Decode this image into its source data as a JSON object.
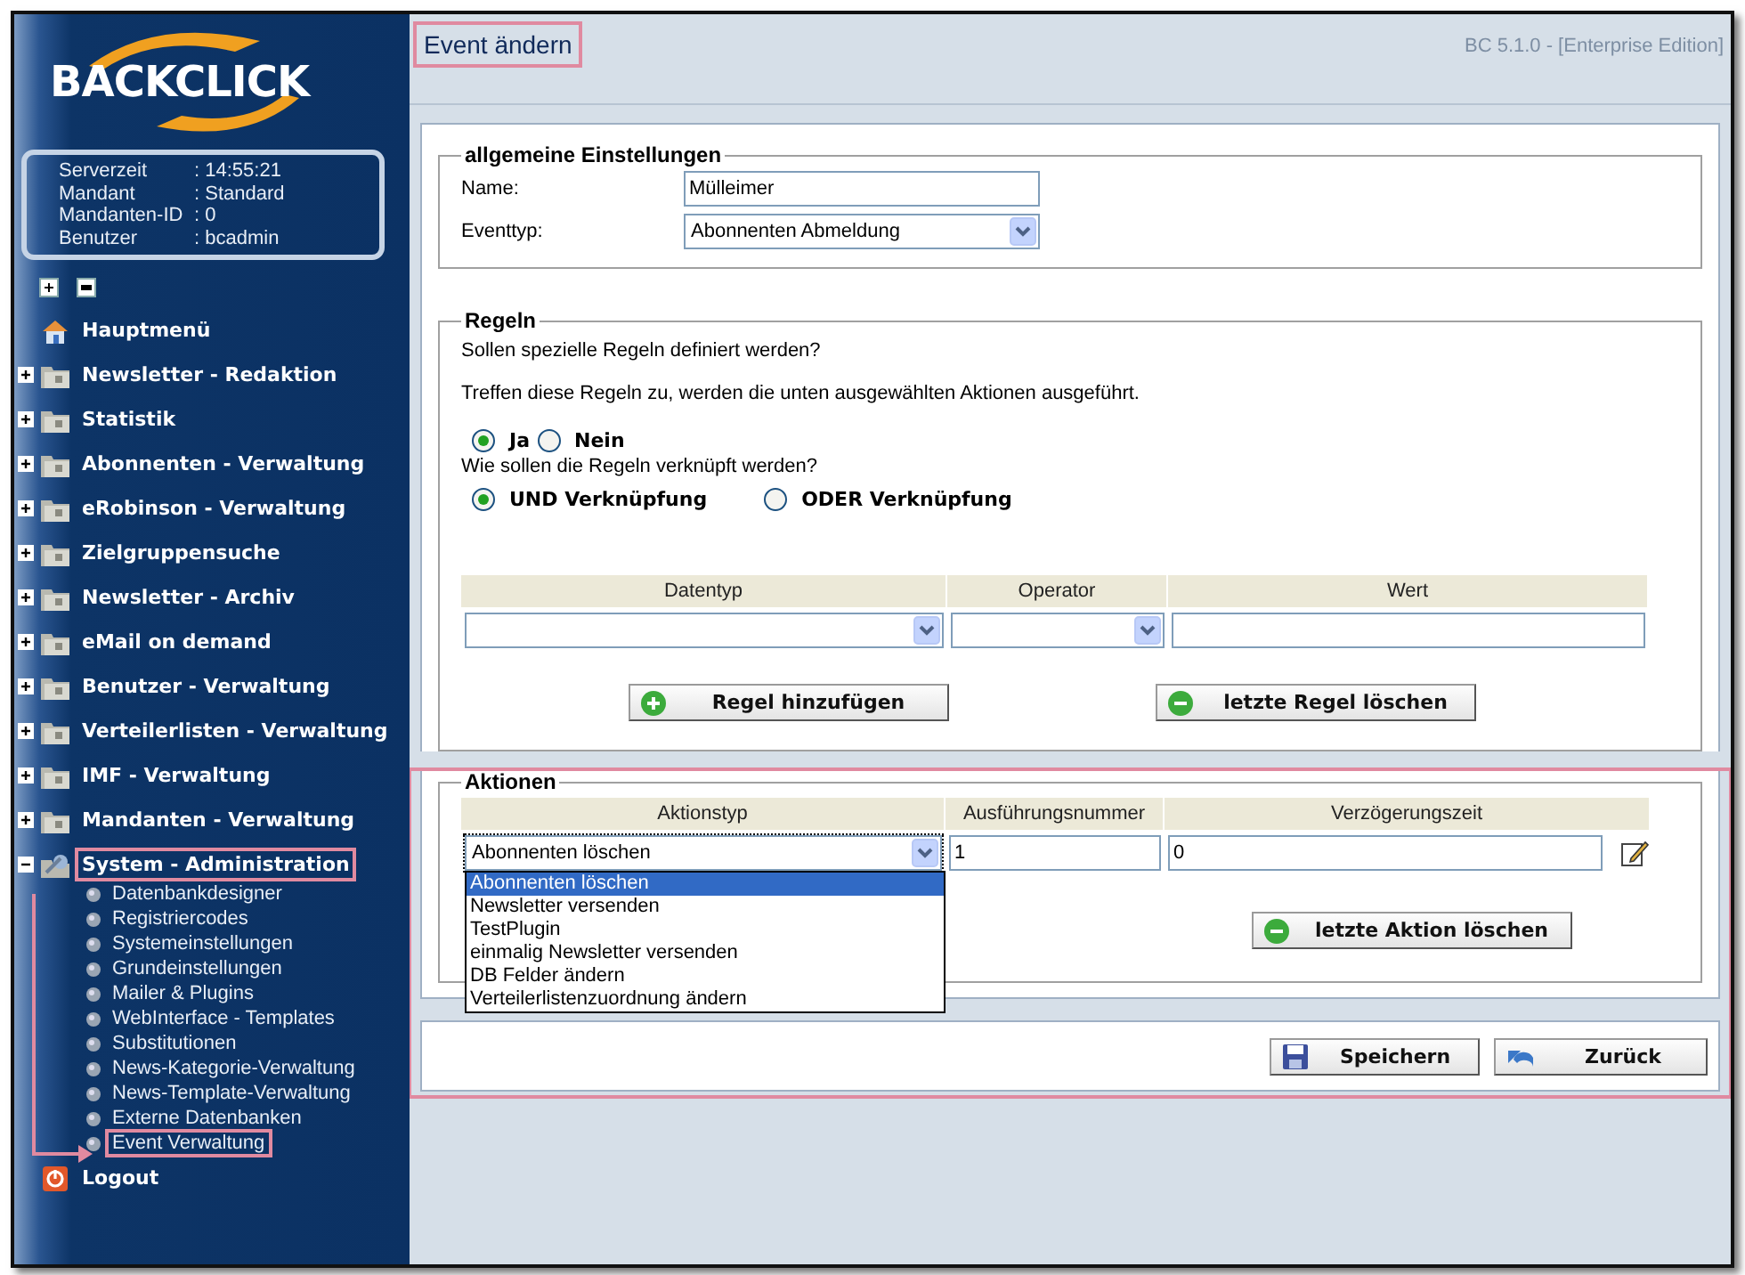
{
  "sidebar": {
    "logo": "BACKCLICK",
    "info": [
      {
        "label": "Serverzeit",
        "value": ": 14:55:21"
      },
      {
        "label": "Mandant",
        "value": ": Standard"
      },
      {
        "label": "Mandanten-ID",
        "value": ": 0"
      },
      {
        "label": "Benutzer",
        "value": ": bcadmin"
      }
    ],
    "nav": [
      {
        "label": "Hauptmenü",
        "kind": "home"
      },
      {
        "label": "Newsletter - Redaktion",
        "kind": "folder",
        "expanded": false,
        "highlighted": false
      },
      {
        "label": "Statistik",
        "kind": "folder",
        "expanded": false,
        "highlighted": false
      },
      {
        "label": "Abonnenten - Verwaltung",
        "kind": "folder",
        "expanded": false,
        "highlighted": false
      },
      {
        "label": "eRobinson - Verwaltung",
        "kind": "folder",
        "expanded": false,
        "highlighted": false
      },
      {
        "label": "Zielgruppensuche",
        "kind": "folder",
        "expanded": false,
        "highlighted": false
      },
      {
        "label": "Newsletter - Archiv",
        "kind": "folder",
        "expanded": false,
        "highlighted": false
      },
      {
        "label": "eMail on demand",
        "kind": "folder",
        "expanded": false,
        "highlighted": false
      },
      {
        "label": "Benutzer - Verwaltung",
        "kind": "folder",
        "expanded": false,
        "highlighted": false
      },
      {
        "label": "Verteilerlisten - Verwaltung",
        "kind": "folder",
        "expanded": false,
        "highlighted": false
      },
      {
        "label": "IMF - Verwaltung",
        "kind": "folder",
        "expanded": false,
        "highlighted": false
      },
      {
        "label": "Mandanten - Verwaltung",
        "kind": "folder",
        "expanded": false,
        "highlighted": false
      },
      {
        "label": "System - Administration",
        "kind": "system",
        "expanded": true,
        "highlighted": true,
        "children": [
          {
            "label": "Datenbankdesigner",
            "highlighted": false
          },
          {
            "label": "Registriercodes",
            "highlighted": false
          },
          {
            "label": "Systemeinstellungen",
            "highlighted": false
          },
          {
            "label": "Grundeinstellungen",
            "highlighted": false
          },
          {
            "label": "Mailer & Plugins",
            "highlighted": false
          },
          {
            "label": "WebInterface - Templates",
            "highlighted": false
          },
          {
            "label": "Substitutionen",
            "highlighted": false
          },
          {
            "label": "News-Kategorie-Verwaltung",
            "highlighted": false
          },
          {
            "label": "News-Template-Verwaltung",
            "highlighted": false
          },
          {
            "label": "Externe Datenbanken",
            "highlighted": false
          },
          {
            "label": "Event Verwaltung",
            "highlighted": true
          }
        ]
      },
      {
        "label": "Logout",
        "kind": "logout"
      }
    ]
  },
  "header": {
    "title": "Event ändern",
    "highlighted": true,
    "version": "BC 5.1.0 - [Enterprise Edition]"
  },
  "general": {
    "legend": "allgemeine Einstellungen",
    "fields": [
      {
        "label": "Name:",
        "kind": "text",
        "value": "Mülleimer"
      },
      {
        "label": "Eventtyp:",
        "kind": "select",
        "value": "Abonnenten Abmeldung"
      }
    ]
  },
  "rules": {
    "legend": "Regeln",
    "question": "Sollen spezielle Regeln definiert werden?",
    "note": "Treffen diese Regeln zu, werden die unten ausgewählten Aktionen ausgeführt.",
    "use_rules": [
      {
        "label": "Ja",
        "selected": true
      },
      {
        "label": "Nein",
        "selected": false
      }
    ],
    "link_question": "Wie sollen die Regeln verknüpft werden?",
    "link_mode": [
      {
        "label": "UND Verknüpfung",
        "selected": true
      },
      {
        "label": "ODER Verknüpfung",
        "selected": false
      }
    ],
    "columns": [
      {
        "label": "Datentyp",
        "kind": "select"
      },
      {
        "label": "Operator",
        "kind": "select"
      },
      {
        "label": "Wert",
        "kind": "text"
      }
    ],
    "buttons": [
      {
        "label": "Regel hinzufügen",
        "kind": "add"
      },
      {
        "label": "letzte Regel löschen",
        "kind": "remove"
      }
    ]
  },
  "actions": {
    "legend": "Aktionen",
    "highlighted": true,
    "columns": [
      "Aktionstyp",
      "Ausführungsnummer",
      "Verzögerungszeit"
    ],
    "row": {
      "type": "Abonnenten löschen",
      "number": "1",
      "delay": "0"
    },
    "dropdown": {
      "expanded": true,
      "options": [
        {
          "label": "Abonnenten löschen",
          "selected": true
        },
        {
          "label": "Newsletter versenden",
          "selected": false
        },
        {
          "label": "TestPlugin",
          "selected": false
        },
        {
          "label": "einmalig Newsletter versenden",
          "selected": false
        },
        {
          "label": "DB Felder ändern",
          "selected": false
        },
        {
          "label": "Verteilerlistenzuordnung ändern",
          "selected": false
        }
      ]
    },
    "buttons": [
      {
        "label": "letzte Aktion löschen",
        "kind": "remove"
      }
    ]
  },
  "footer_buttons": [
    {
      "label": "Speichern",
      "kind": "save"
    },
    {
      "label": "Zurück",
      "kind": "back"
    }
  ]
}
